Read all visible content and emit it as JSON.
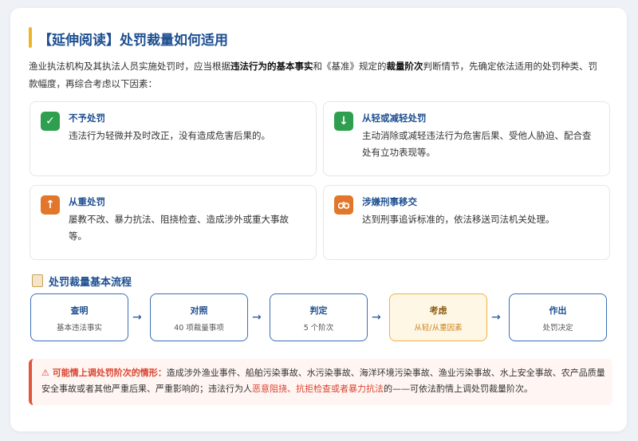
{
  "header": {
    "title": "【延伸阅读】处罚裁量如何适用"
  },
  "intro": {
    "p1": "渔业执法机构及其执法人员实施处罚时，应当根据",
    "b1": "违法行为的基本事实",
    "p2": "和《基准》规定的",
    "b2": "裁量阶次",
    "p3": "判断情节，先确定依法适用的处罚种类、罚款幅度，再综合考虑以下因素："
  },
  "factors": [
    {
      "icon": "✓",
      "icon_name": "check-icon",
      "color": "#2e9e4f",
      "title": "不予处罚",
      "text": "违法行为轻微并及时改正，没有造成危害后果的。"
    },
    {
      "icon": "↓",
      "icon_name": "arrow-down-icon",
      "color": "#2e9e4f",
      "title": "从轻或减轻处罚",
      "text": "主动消除或减轻违法行为危害后果、受他人胁迫、配合查处有立功表现等。"
    },
    {
      "icon": "↑",
      "icon_name": "arrow-up-icon",
      "color": "#e2762a",
      "title": "从重处罚",
      "text": "屡教不改、暴力抗法、阻挠检查、造成涉外或重大事故等。"
    },
    {
      "icon": "✚",
      "icon_name": "handcuffs-icon",
      "color": "#e2762a",
      "title": "涉嫌刑事移交",
      "text": "达到刑事追诉标准的，依法移送司法机关处理。"
    }
  ],
  "flow": {
    "title": "处罚裁量基本流程",
    "steps": [
      {
        "title": "查明",
        "sub": "基本违法事实"
      },
      {
        "title": "对照",
        "sub": "40 项裁量事项"
      },
      {
        "title": "判定",
        "sub": "5 个阶次"
      },
      {
        "title": "考虑",
        "sub": "从轻/从重因素"
      },
      {
        "title": "作出",
        "sub": "处罚决定"
      }
    ],
    "arrow": "→"
  },
  "warning": {
    "lead": "⚠ 可能情上调处罚阶次的情形：",
    "p1": "造成涉外渔业事件、船舶污染事故、水污染事故、海洋环境污染事故、渔业污染事故、水上安全事故、农产品质量安全事故或者其他严重后果、严重影响的；违法行为人",
    "red": "恶意阻挠、抗拒检查或者暴力抗法",
    "p2": "的——可依法酌情上调处罚裁量阶次。"
  },
  "colors": {
    "accent": "#1d4f91",
    "highlight": "#f0b13c",
    "warning": "#e0553b"
  }
}
